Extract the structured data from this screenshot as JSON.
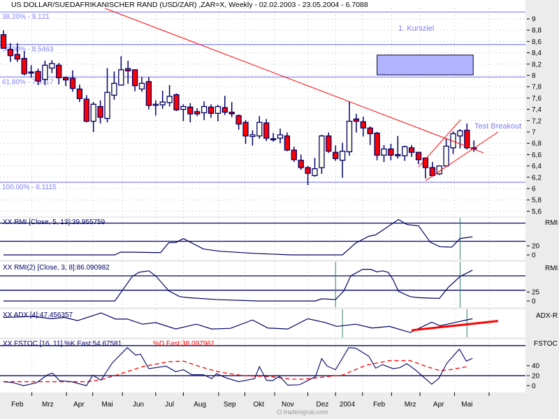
{
  "title": "US DOLLAR/SUEDAFRIKANISCHER RAND (USD/ZAR) ,ZAR=X, Weekly - 02.02.2003 - 23.05.2004 - 6.7088",
  "footer": "tradesignal.com",
  "colors": {
    "up_fill": "#fffff0",
    "down_fill": "#ff0000",
    "outline": "#000066",
    "fib": "#8080ff",
    "trend": "#ff0000",
    "marker": "#2e7d6e",
    "box": "#b0b4ff",
    "axis_bg": "#ececec"
  },
  "chart_data": [
    {
      "type": "candlestick",
      "title": "US DOLLAR/SUEDAFRIKANISCHER RAND (USD/ZAR) ,ZAR=X, Weekly",
      "ylim": [
        5.5,
        9.2
      ],
      "yticks": [
        9,
        8.8,
        8.6,
        8.4,
        8.2,
        8,
        7.8,
        7.6,
        7.4,
        7.2,
        7,
        6.8,
        6.6,
        6.4,
        6.2,
        6,
        5.8,
        5.6
      ],
      "ytick_labels": [
        "9",
        "8,8",
        "8,6",
        "8,4",
        "8,2",
        "8",
        "7,8",
        "7,6",
        "7,4",
        "7,2",
        "7",
        "6,8",
        "6,6",
        "6,4",
        "6,2",
        "6",
        "5,8",
        "5,6"
      ],
      "xlabels": [
        {
          "label": "Feb",
          "week": 2
        },
        {
          "label": "Mrz",
          "week": 6.4
        },
        {
          "label": "Apr",
          "week": 10.9
        },
        {
          "label": "Mai",
          "week": 15
        },
        {
          "label": "Jun",
          "week": 19.5
        },
        {
          "label": "Jul",
          "week": 24
        },
        {
          "label": "Aug",
          "week": 28.4
        },
        {
          "label": "Sep",
          "week": 32.7
        },
        {
          "label": "Okt",
          "week": 36.9
        },
        {
          "label": "Nov",
          "week": 41.1
        },
        {
          "label": "Dez",
          "week": 46.1
        },
        {
          "label": "2004",
          "week": 49.7
        },
        {
          "label": "Feb",
          "week": 54.3
        },
        {
          "label": "Mrz",
          "week": 58.8
        },
        {
          "label": "Apr",
          "week": 62.9
        },
        {
          "label": "Mai",
          "week": 67
        }
      ],
      "month_boundaries": [
        4.1,
        9.1,
        12.9,
        17.2,
        22,
        26,
        31.1,
        34.9,
        39.2,
        44,
        48,
        51.9,
        56.1,
        60.2,
        65.2,
        70.2
      ],
      "ohlc": [
        [
          8.72,
          8.8,
          8.47,
          8.48
        ],
        [
          8.46,
          8.57,
          8.24,
          8.35
        ],
        [
          8.37,
          8.57,
          8.24,
          8.29
        ],
        [
          8.3,
          8.43,
          8.0,
          8.03
        ],
        [
          8.06,
          8.18,
          7.96,
          8.05
        ],
        [
          8.07,
          8.12,
          7.83,
          7.9
        ],
        [
          7.93,
          8.26,
          7.83,
          8.18
        ],
        [
          8.13,
          8.27,
          8.04,
          8.21
        ],
        [
          8.18,
          8.22,
          7.84,
          7.96
        ],
        [
          7.96,
          7.98,
          7.81,
          7.92
        ],
        [
          7.95,
          8.09,
          7.71,
          7.77
        ],
        [
          7.76,
          7.84,
          7.53,
          7.59
        ],
        [
          7.58,
          7.65,
          7.17,
          7.19
        ],
        [
          7.19,
          7.53,
          7.0,
          7.49
        ],
        [
          7.45,
          7.56,
          7.15,
          7.26
        ],
        [
          7.24,
          8.13,
          7.17,
          7.7
        ],
        [
          7.65,
          8.07,
          7.57,
          7.86
        ],
        [
          7.83,
          8.34,
          7.82,
          8.1
        ],
        [
          8.12,
          8.26,
          7.85,
          8.08
        ],
        [
          8.1,
          8.1,
          7.72,
          7.82
        ],
        [
          7.76,
          7.97,
          7.71,
          7.86
        ],
        [
          7.89,
          7.97,
          7.4,
          7.47
        ],
        [
          7.47,
          7.56,
          7.29,
          7.49
        ],
        [
          7.48,
          7.73,
          7.41,
          7.53
        ],
        [
          7.52,
          7.83,
          7.45,
          7.63
        ],
        [
          7.66,
          7.68,
          7.37,
          7.39
        ],
        [
          7.4,
          7.49,
          7.19,
          7.45
        ],
        [
          7.44,
          7.51,
          7.17,
          7.32
        ],
        [
          7.36,
          7.42,
          7.28,
          7.32
        ],
        [
          7.34,
          7.54,
          7.21,
          7.45
        ],
        [
          7.44,
          7.49,
          7.25,
          7.33
        ],
        [
          7.33,
          7.48,
          7.19,
          7.45
        ],
        [
          7.43,
          7.64,
          7.3,
          7.35
        ],
        [
          7.35,
          7.53,
          7.26,
          7.32
        ],
        [
          7.29,
          7.31,
          7.04,
          7.14
        ],
        [
          7.17,
          7.21,
          6.79,
          6.93
        ],
        [
          6.92,
          7.03,
          6.76,
          6.95
        ],
        [
          6.93,
          7.28,
          6.88,
          7.17
        ],
        [
          7.16,
          7.23,
          6.84,
          6.89
        ],
        [
          6.88,
          6.98,
          6.83,
          6.87
        ],
        [
          6.89,
          7.06,
          6.8,
          6.95
        ],
        [
          6.93,
          6.99,
          6.66,
          6.68
        ],
        [
          6.68,
          6.74,
          6.47,
          6.51
        ],
        [
          6.5,
          6.6,
          6.33,
          6.37
        ],
        [
          6.37,
          6.4,
          6.06,
          6.27
        ],
        [
          6.23,
          6.54,
          6.21,
          6.35
        ],
        [
          6.37,
          6.95,
          6.26,
          6.93
        ],
        [
          6.93,
          6.99,
          6.63,
          6.66
        ],
        [
          6.64,
          6.76,
          6.49,
          6.53
        ],
        [
          6.5,
          6.81,
          6.19,
          6.66
        ],
        [
          6.65,
          7.54,
          6.58,
          7.19
        ],
        [
          7.23,
          7.32,
          6.99,
          7.19
        ],
        [
          7.18,
          7.27,
          6.92,
          7.07
        ],
        [
          7.07,
          7.1,
          6.77,
          6.97
        ],
        [
          6.98,
          7.0,
          6.5,
          6.59
        ],
        [
          6.59,
          6.77,
          6.47,
          6.7
        ],
        [
          6.7,
          6.79,
          6.5,
          6.59
        ],
        [
          6.6,
          6.93,
          6.53,
          6.58
        ],
        [
          6.58,
          6.76,
          6.49,
          6.74
        ],
        [
          6.72,
          6.77,
          6.56,
          6.64
        ],
        [
          6.64,
          6.64,
          6.43,
          6.51
        ],
        [
          6.54,
          6.55,
          6.18,
          6.37
        ],
        [
          6.37,
          6.47,
          6.21,
          6.23
        ],
        [
          6.26,
          6.41,
          6.24,
          6.4
        ],
        [
          6.4,
          6.89,
          6.39,
          6.75
        ],
        [
          6.72,
          7.01,
          6.61,
          6.97
        ],
        [
          6.93,
          7.05,
          6.71,
          7.02
        ],
        [
          7.03,
          7.15,
          6.69,
          6.72
        ],
        [
          6.72,
          6.85,
          6.65,
          6.7088
        ]
      ],
      "fib_levels": [
        {
          "label": "38.20% - 9.121",
          "price": 9.121
        },
        {
          "label": "50.00% - 8.5463",
          "price": 8.5463
        },
        {
          "label": "61.80% - 7.9717",
          "price": 7.9717
        },
        {
          "label": "100.00% - 6.1115",
          "price": 6.1115
        }
      ],
      "trendlines": [
        {
          "name": "downtrend",
          "from": [
            13.3,
            9.25
          ],
          "to": [
            69.4,
            6.63
          ]
        },
        {
          "name": "channel-upper",
          "from": [
            60,
            6.38
          ],
          "to": [
            66.1,
            7.22
          ]
        },
        {
          "name": "channel-lower",
          "from": [
            61,
            6.14
          ],
          "to": [
            71.5,
            7.0
          ]
        }
      ],
      "target_box": {
        "weeks": [
          54,
          67.9
        ],
        "prices": [
          8.01,
          8.36
        ]
      },
      "annotations": [
        {
          "text": "1. Kursziel",
          "week": 56.5,
          "price": 8.8
        },
        {
          "text": "Test Breakout",
          "week": 68,
          "price": 7.08
        }
      ]
    },
    {
      "type": "line",
      "name": "rmi1",
      "label": "XX RMI [Close, 5, 13]:39.955759",
      "axis_label": "RMI",
      "yticks": [
        20,
        0
      ],
      "levels": [
        70,
        30
      ],
      "markers": [
        66
      ],
      "points": [
        [
          0,
          0
        ],
        [
          16.1,
          0
        ],
        [
          16.9,
          6
        ],
        [
          18.4,
          6
        ],
        [
          22.7,
          5
        ],
        [
          23.9,
          27
        ],
        [
          24.9,
          27
        ],
        [
          26,
          36
        ],
        [
          28.9,
          13
        ],
        [
          31.3,
          8
        ],
        [
          36.7,
          3
        ],
        [
          41.6,
          0
        ],
        [
          49,
          0
        ],
        [
          50.9,
          26
        ],
        [
          52.8,
          41
        ],
        [
          53.8,
          44
        ],
        [
          57.1,
          78
        ],
        [
          58.3,
          67
        ],
        [
          60,
          64
        ],
        [
          61.7,
          28
        ],
        [
          63.1,
          18
        ],
        [
          64.8,
          17
        ],
        [
          66,
          36
        ],
        [
          67.8,
          40
        ]
      ]
    },
    {
      "type": "line",
      "name": "rmi2",
      "label": "XX RMI(2) [Close, 3, 8]:86.090982",
      "axis_label": "RMI",
      "yticks": [
        25,
        0
      ],
      "levels": [
        70,
        30
      ],
      "markers": [
        48,
        66
      ],
      "points": [
        [
          0,
          0
        ],
        [
          16.1,
          0
        ],
        [
          18.6,
          68
        ],
        [
          19.6,
          80
        ],
        [
          21,
          84
        ],
        [
          22,
          70
        ],
        [
          23.9,
          28
        ],
        [
          25.5,
          12
        ],
        [
          26.9,
          9
        ],
        [
          30.8,
          4
        ],
        [
          36.7,
          0
        ],
        [
          45.1,
          0
        ],
        [
          46,
          6
        ],
        [
          48,
          4
        ],
        [
          49.2,
          28
        ],
        [
          50.2,
          70
        ],
        [
          51.9,
          88
        ],
        [
          53.1,
          88
        ],
        [
          54,
          81
        ],
        [
          54.8,
          84
        ],
        [
          55.6,
          80
        ],
        [
          56.3,
          60
        ],
        [
          57.1,
          27
        ],
        [
          58.8,
          12
        ],
        [
          60.2,
          9
        ],
        [
          63,
          7
        ],
        [
          64.3,
          38
        ],
        [
          66,
          68
        ],
        [
          67.8,
          86
        ]
      ]
    },
    {
      "type": "line",
      "name": "adx",
      "label": "XX ADX [4]:47.456357",
      "axis_label": "ADX-R",
      "yticks": [],
      "levels": [],
      "markers": [
        49,
        67
      ],
      "points": [
        [
          0,
          51
        ],
        [
          4.3,
          54
        ],
        [
          6.9,
          47
        ],
        [
          8.8,
          51
        ],
        [
          10.7,
          41
        ],
        [
          14.1,
          65
        ],
        [
          16.2,
          46
        ],
        [
          17.9,
          46
        ],
        [
          20.1,
          30
        ],
        [
          22,
          35
        ],
        [
          24.9,
          15
        ],
        [
          27.9,
          30
        ],
        [
          30.1,
          15
        ],
        [
          32.8,
          17
        ],
        [
          36,
          43
        ],
        [
          38.2,
          18
        ],
        [
          41.1,
          15
        ],
        [
          44,
          47
        ],
        [
          46.5,
          35
        ],
        [
          48.2,
          23
        ],
        [
          50.9,
          30
        ],
        [
          53.3,
          18
        ],
        [
          55.8,
          23
        ],
        [
          58.8,
          4
        ],
        [
          61.9,
          36
        ],
        [
          63.1,
          25
        ],
        [
          65.2,
          35
        ],
        [
          67.8,
          47
        ]
      ],
      "trendline": {
        "from": [
          59,
          11
        ],
        "to": [
          71.5,
          40
        ]
      }
    },
    {
      "type": "line",
      "name": "fstoc",
      "label_k": "XX FSTOC [16, 11] %K Fast:54.67581",
      "label_d": "%D Fast:38.097961",
      "axis_label": "FSTOC",
      "yticks": [
        40,
        20,
        0
      ],
      "levels": [
        80,
        20
      ],
      "k_points": [
        [
          0,
          8
        ],
        [
          1.4,
          6
        ],
        [
          2.9,
          0
        ],
        [
          4.8,
          6
        ],
        [
          6.4,
          22
        ],
        [
          7.1,
          25
        ],
        [
          8.1,
          10
        ],
        [
          9.8,
          8
        ],
        [
          12,
          0
        ],
        [
          12.9,
          21
        ],
        [
          14.1,
          11
        ],
        [
          15.7,
          45
        ],
        [
          17.9,
          76
        ],
        [
          19.1,
          61
        ],
        [
          19.8,
          63
        ],
        [
          21,
          34
        ],
        [
          23.5,
          39
        ],
        [
          24.9,
          28
        ],
        [
          26,
          32
        ],
        [
          27.2,
          22
        ],
        [
          28.9,
          22
        ],
        [
          30.1,
          14
        ],
        [
          30.8,
          24
        ],
        [
          32.3,
          15
        ],
        [
          34,
          8
        ],
        [
          36.3,
          14
        ],
        [
          37,
          38
        ],
        [
          38,
          11
        ],
        [
          38.9,
          10
        ],
        [
          39.9,
          19
        ],
        [
          41.1,
          1
        ],
        [
          42.8,
          2
        ],
        [
          45.1,
          18
        ],
        [
          46,
          54
        ],
        [
          46.8,
          39
        ],
        [
          48,
          32
        ],
        [
          49.9,
          76
        ],
        [
          50.9,
          75
        ],
        [
          52.8,
          59
        ],
        [
          53.8,
          35
        ],
        [
          54.8,
          42
        ],
        [
          56.3,
          34
        ],
        [
          57.3,
          36
        ],
        [
          58.3,
          44
        ],
        [
          59.5,
          32
        ],
        [
          61.9,
          3
        ],
        [
          62.9,
          14
        ],
        [
          64.1,
          45
        ],
        [
          65.9,
          73
        ],
        [
          66.9,
          49
        ],
        [
          67.8,
          54.7
        ]
      ],
      "d_points": [
        [
          0,
          8
        ],
        [
          5.4,
          8
        ],
        [
          12.2,
          8
        ],
        [
          14.1,
          12
        ],
        [
          17.2,
          25
        ],
        [
          20.1,
          38
        ],
        [
          23.9,
          48
        ],
        [
          26,
          49
        ],
        [
          28.9,
          36
        ],
        [
          31.3,
          27
        ],
        [
          34.7,
          20
        ],
        [
          38.7,
          18
        ],
        [
          41.6,
          13
        ],
        [
          43.5,
          13
        ],
        [
          48,
          20
        ],
        [
          49,
          21
        ],
        [
          52.4,
          41
        ],
        [
          55.8,
          50
        ],
        [
          58.8,
          50
        ],
        [
          61.2,
          38
        ],
        [
          63.1,
          30
        ],
        [
          64.6,
          32
        ],
        [
          67.1,
          38.1
        ]
      ]
    }
  ]
}
